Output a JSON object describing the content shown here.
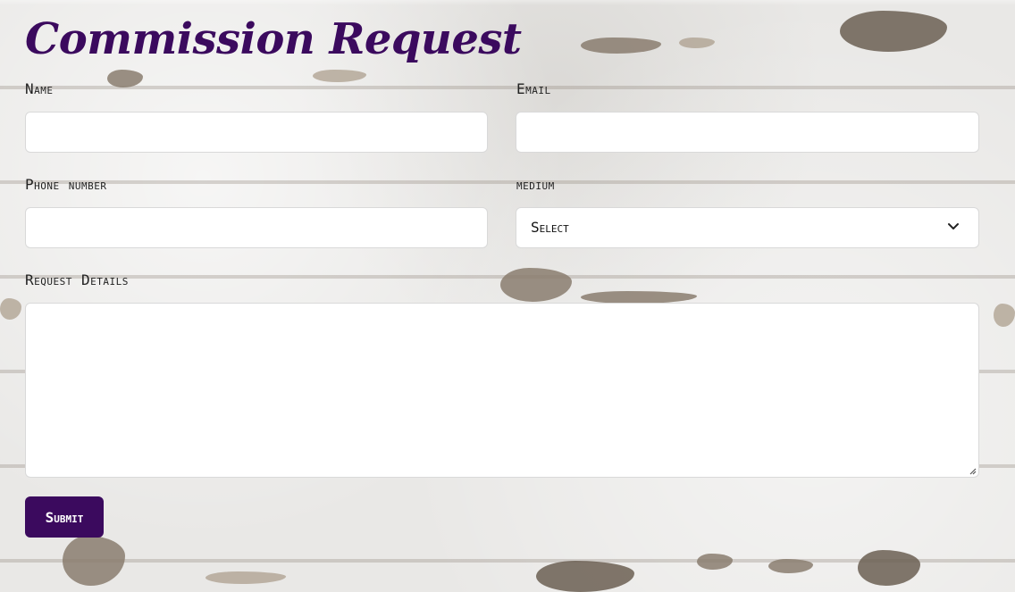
{
  "form": {
    "title": "Commission Request",
    "fields": {
      "name": {
        "label": "Name",
        "value": ""
      },
      "email": {
        "label": "Email",
        "value": ""
      },
      "phone": {
        "label": "Phone number",
        "value": ""
      },
      "medium": {
        "label": "medium",
        "selected": "Select"
      },
      "details": {
        "label": "Request Details",
        "value": ""
      }
    },
    "submit_label": "Submit"
  },
  "colors": {
    "accent": "#3b0a5e",
    "field_bg": "#ffffff",
    "wall": "#e9e8e6"
  },
  "icons": {
    "medium_dropdown": "chevron-down-icon",
    "details_resize": "resize-handle-icon"
  }
}
